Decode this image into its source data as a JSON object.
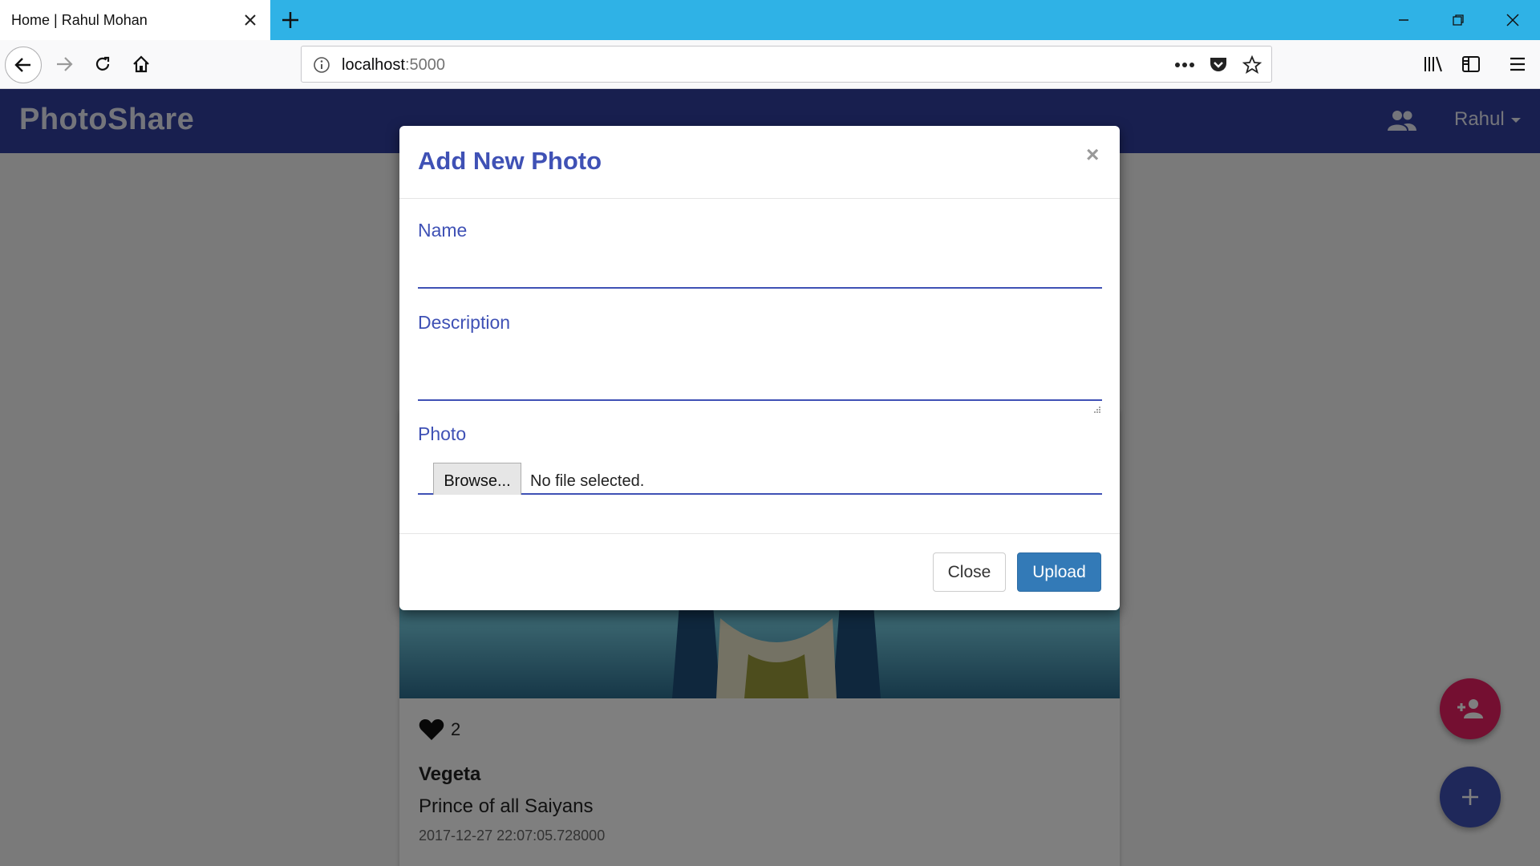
{
  "browser": {
    "tab_title": "Home | Rahul Mohan",
    "url_host": "localhost",
    "url_port": ":5000"
  },
  "app": {
    "brand": "PhotoShare",
    "user_name": "Rahul"
  },
  "card": {
    "likes": "2",
    "title": "Vegeta",
    "description": "Prince of all Saiyans",
    "date": "2017-12-27 22:07:05.728000"
  },
  "modal": {
    "title": "Add New Photo",
    "close_x": "×",
    "name_label": "Name",
    "name_value": "",
    "description_label": "Description",
    "description_value": "",
    "photo_label": "Photo",
    "browse_label": "Browse...",
    "file_status": "No file selected.",
    "close_button": "Close",
    "upload_button": "Upload"
  },
  "colors": {
    "brand_indigo": "#303f9f",
    "accent_indigo": "#3f51b5",
    "fab_pink": "#e91e63",
    "upload_blue": "#337ab7",
    "tabbar_blue": "#2fb2e6"
  }
}
